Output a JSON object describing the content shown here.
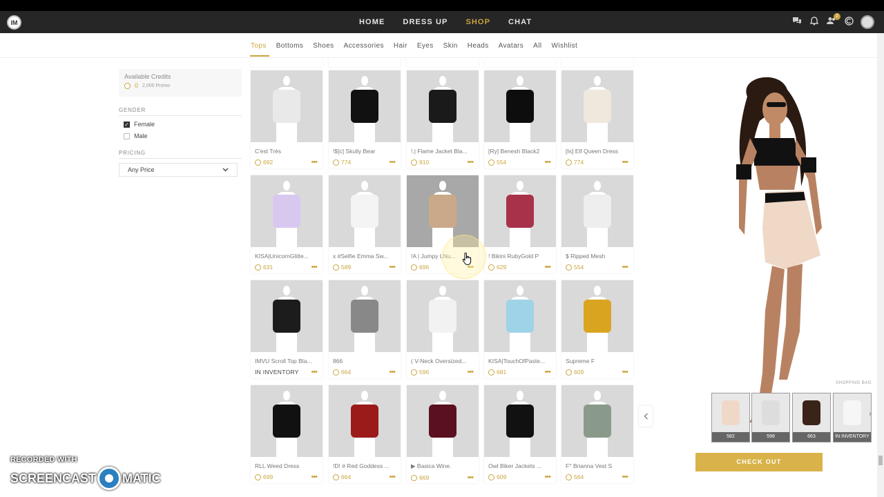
{
  "nav": {
    "links": [
      {
        "label": "HOME",
        "active": false
      },
      {
        "label": "DRESS UP",
        "active": false
      },
      {
        "label": "SHOP",
        "active": true
      },
      {
        "label": "CHAT",
        "active": false
      }
    ],
    "notification_count": "2",
    "accent_color": "#c9a43c"
  },
  "categories": [
    "Tops",
    "Bottoms",
    "Shoes",
    "Accessories",
    "Hair",
    "Eyes",
    "Skin",
    "Heads",
    "Avatars",
    "All",
    "Wishlist"
  ],
  "active_category": "Tops",
  "sidebar": {
    "credits_label": "Available Credits",
    "credits_value": "0",
    "promo": "2,000 Promo",
    "gender_title": "GENDER",
    "gender_options": [
      {
        "label": "Female",
        "checked": true
      },
      {
        "label": "Male",
        "checked": false
      }
    ],
    "pricing_title": "PRICING",
    "pricing_selected": "Any Price"
  },
  "products": [
    [
      {
        "name": "C'est Très",
        "price": "692",
        "color": "#e9e9e9"
      },
      {
        "name": "!$[c] Skully Bear",
        "price": "774",
        "color": "#111111"
      },
      {
        "name": "!.| Flame Jacket Bla...",
        "price": "910",
        "color": "#1a1a1a"
      },
      {
        "name": "[Ry] Benesh Black2",
        "price": "554",
        "color": "#0d0d0d"
      },
      {
        "name": "[Is] Elf Queen Dress",
        "price": "774",
        "color": "#efe8dc"
      }
    ],
    [
      {
        "name": "KISA|UnicornGlitte...",
        "price": "631",
        "color": "#d8c8f0"
      },
      {
        "name": "x #Selfie Emma Sw...",
        "price": "589",
        "color": "#f4f4f4"
      },
      {
        "name": "!A | Jumpy LNu...",
        "price": "696",
        "color": "#c9a98a"
      },
      {
        "name": "! Bikini RubyGold P",
        "price": "629",
        "color": "#a8324a"
      },
      {
        "name": "$ Ripped Mesh",
        "price": "554",
        "color": "#eeeeee"
      }
    ],
    [
      {
        "name": "IMVU Scroll Top Bla...",
        "price": "IN INVENTORY",
        "color": "#1c1c1c"
      },
      {
        "name": "866",
        "price": "664",
        "color": "#888888"
      },
      {
        "name": "( V-Neck Oversized...",
        "price": "596",
        "color": "#f2f2f2"
      },
      {
        "name": "KISA|TouchOfPaste...",
        "price": "681",
        "color": "#9fd3e8"
      },
      {
        "name": "Supreme F",
        "price": "609",
        "color": "#d9a520"
      }
    ],
    [
      {
        "name": "RLL Weed Dress",
        "price": "699",
        "color": "#111111"
      },
      {
        "name": "!D! # Red Goddess ...",
        "price": "664",
        "color": "#9b1b1b"
      },
      {
        "name": "▶ Basica Wine.",
        "price": "669",
        "color": "#5a1020"
      },
      {
        "name": "Owl Biker Jackets ...",
        "price": "609",
        "color": "#111111"
      },
      {
        "name": "F° Brianna Vest S",
        "price": "564",
        "color": "#8a9a8a"
      }
    ]
  ],
  "shopping_bag": {
    "label": "SHOPPING BAG",
    "items": [
      {
        "price": "582",
        "color": "#f0d8c8"
      },
      {
        "price": "598",
        "color": "#dddddd"
      },
      {
        "price": "663",
        "color": "#3a2418"
      },
      {
        "price": "IN INVENTORY",
        "color": "#f6f6f6"
      }
    ]
  },
  "checkout_label": "CHECK OUT",
  "watermark": {
    "line1": "RECORDED WITH",
    "line2a": "SCREENCAST",
    "line2b": "MATIC"
  }
}
